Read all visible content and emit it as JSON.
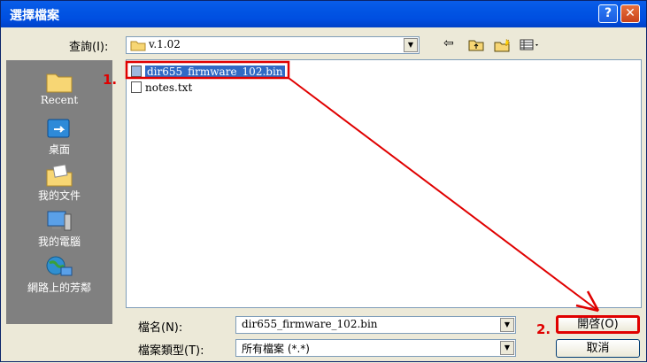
{
  "dialog": {
    "title": "選擇檔案",
    "help_label": "?",
    "close_label": "✕"
  },
  "lookin": {
    "label": "查詢(I):",
    "value": "v.1.02"
  },
  "toolbar": {
    "back_icon": "arrow-left-icon",
    "up_icon": "up-folder-icon",
    "new_folder_icon": "new-folder-icon",
    "views_icon": "views-menu-icon"
  },
  "places": [
    {
      "label": "Recent",
      "icon": "recent-folder-icon"
    },
    {
      "label": "桌面",
      "icon": "desktop-icon"
    },
    {
      "label": "我的文件",
      "icon": "my-documents-icon"
    },
    {
      "label": "我的電腦",
      "icon": "my-computer-icon"
    },
    {
      "label": "網路上的芳鄰",
      "icon": "network-places-icon"
    }
  ],
  "files": [
    {
      "name": "dir655_firmware_102.bin",
      "selected": true
    },
    {
      "name": "notes.txt",
      "selected": false
    }
  ],
  "filename": {
    "label": "檔名(N):",
    "value": "dir655_firmware_102.bin"
  },
  "filetype": {
    "label": "檔案類型(T):",
    "value": "所有檔案 (*.*)"
  },
  "buttons": {
    "open": "開啓(O)",
    "cancel": "取消"
  },
  "annotations": {
    "step1": "1.",
    "step2": "2.",
    "color": "#e00000"
  }
}
